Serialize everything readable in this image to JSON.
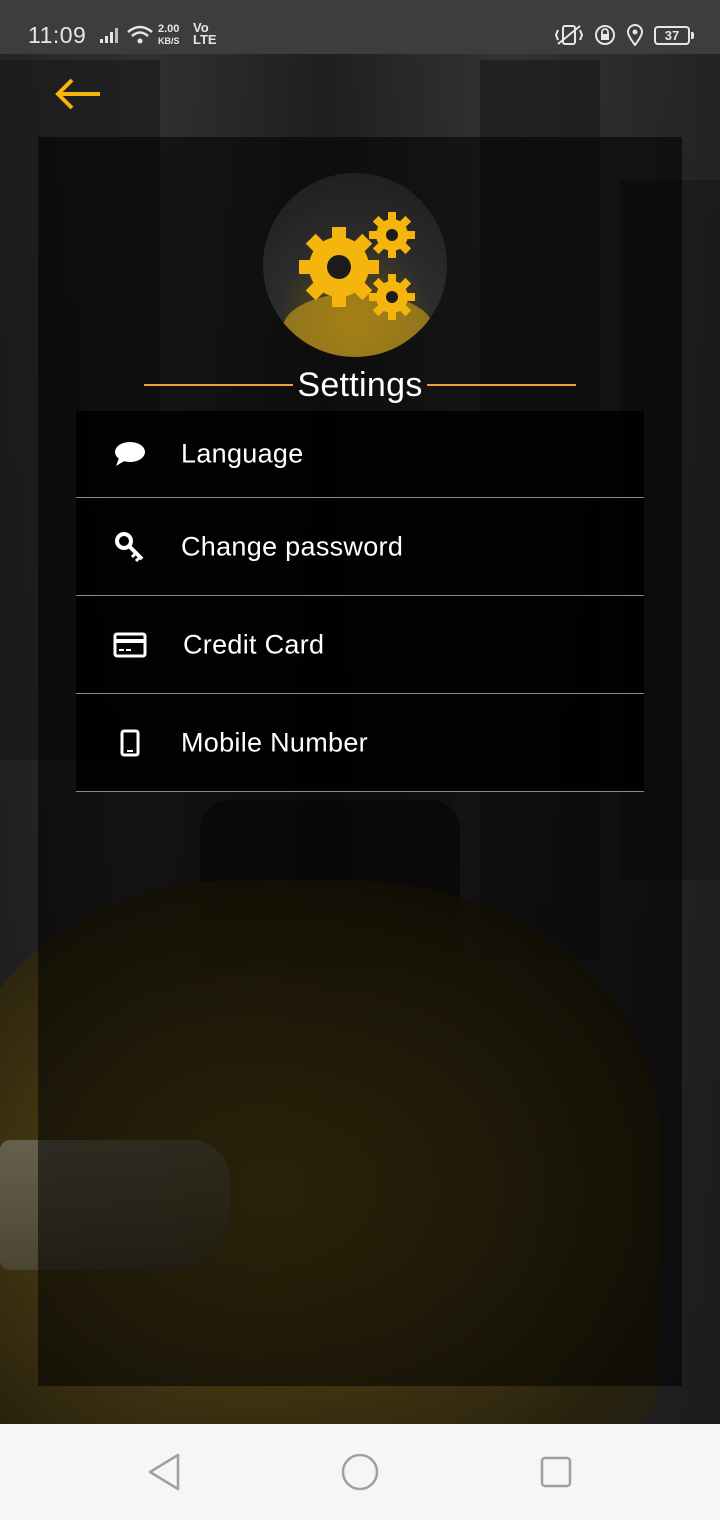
{
  "status_bar": {
    "time": "11:09",
    "net_speed_value": "2.00",
    "net_speed_unit": "KB/S",
    "volte_top": "Vo",
    "volte_bottom": "LTE",
    "battery": "37"
  },
  "header": {
    "back_icon": "arrow-left-icon"
  },
  "settings": {
    "title": "Settings",
    "header_icon": "gears-icon",
    "items": [
      {
        "label": "Language",
        "icon": "chat-bubble-icon"
      },
      {
        "label": "Change password",
        "icon": "key-icon"
      },
      {
        "label": "Credit Card",
        "icon": "credit-card-icon"
      },
      {
        "label": "Mobile Number",
        "icon": "mobile-phone-icon"
      }
    ]
  },
  "colors": {
    "accent": "#e8a531",
    "gear": "#f5b50d",
    "text": "#ffffff",
    "divider": "#8a8a8a"
  },
  "nav_bar": {
    "back": "triangle-back-icon",
    "home": "circle-home-icon",
    "recents": "square-recents-icon"
  }
}
